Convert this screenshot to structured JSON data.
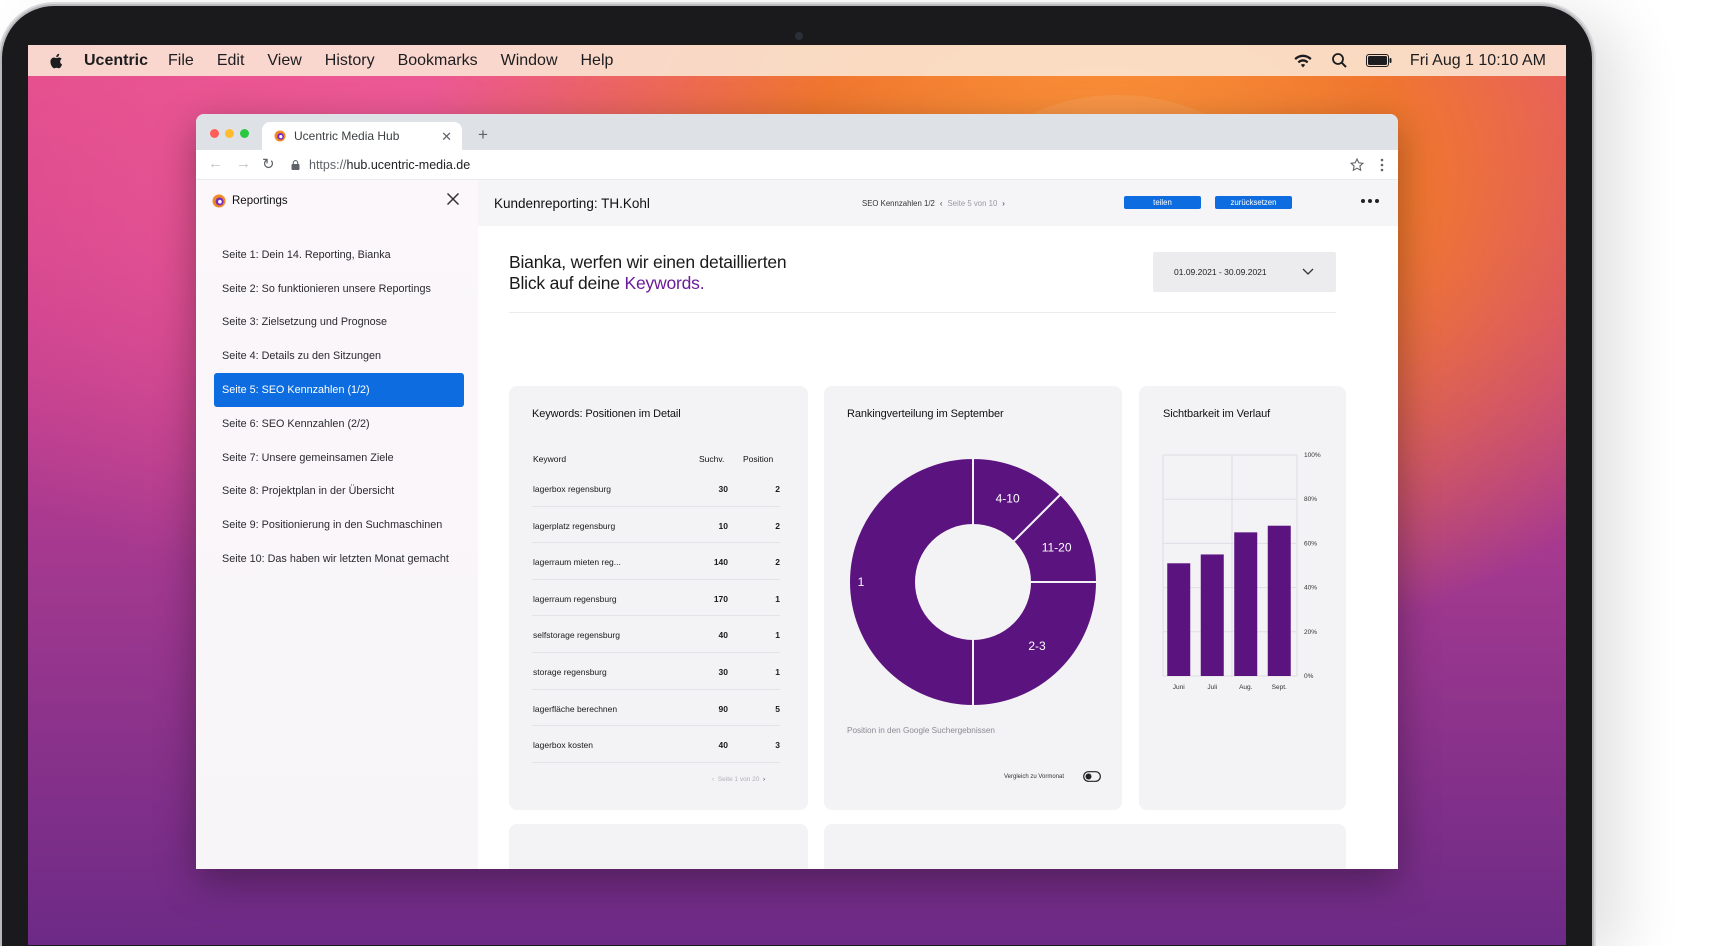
{
  "menubar": {
    "app_name": "Ucentric",
    "items": [
      "File",
      "Edit",
      "View",
      "History",
      "Bookmarks",
      "Window",
      "Help"
    ],
    "clock": "Fri Aug 1  10:10 AM"
  },
  "browser": {
    "tab_title": "Ucentric Media Hub",
    "url_scheme": "https://",
    "url_host": "hub.ucentric-media.de"
  },
  "sidebar": {
    "title": "Reportings",
    "items": [
      {
        "label": "Seite 1: Dein 14. Reporting, Bianka"
      },
      {
        "label": "Seite 2: So funktionieren unsere Reportings"
      },
      {
        "label": "Seite 3: Zielsetzung und Prognose"
      },
      {
        "label": "Seite 4: Details zu den Sitzungen"
      },
      {
        "label": "Seite 5: SEO Kennzahlen (1/2)"
      },
      {
        "label": "Seite 6: SEO Kennzahlen (2/2)"
      },
      {
        "label": "Seite 7: Unsere gemeinsamen Ziele"
      },
      {
        "label": "Seite 8: Projektplan in der Übersicht"
      },
      {
        "label": "Seite 9: Positionierung in den Suchmaschinen"
      },
      {
        "label": "Seite 10: Das haben wir letzten Monat gemacht"
      }
    ],
    "active_index": 4
  },
  "header": {
    "title": "Kundenreporting: TH.Kohl",
    "section": "SEO Kennzahlen 1/2",
    "page_info": "Seite 5 von 10",
    "share_label": "teilen",
    "reset_label": "zurücksetzen"
  },
  "content": {
    "headline_line1": "Bianka, werfen wir einen detaillierten",
    "headline_line2": "Blick auf deine ",
    "headline_accent": "Keywords.",
    "date_range": "01.09.2021 - 30.09.2021"
  },
  "keywords": {
    "title": "Keywords: Positionen im Detail",
    "col_keyword": "Keyword",
    "col_volume": "Suchv.",
    "col_position": "Position",
    "rows": [
      {
        "keyword": "lagerbox regensburg",
        "volume": "30",
        "position": "2"
      },
      {
        "keyword": "lagerplatz regensburg",
        "volume": "10",
        "position": "2"
      },
      {
        "keyword": "lagerraum mieten reg...",
        "volume": "140",
        "position": "2"
      },
      {
        "keyword": "lagerraum regensburg",
        "volume": "170",
        "position": "1"
      },
      {
        "keyword": "selfstorage regensburg",
        "volume": "40",
        "position": "1"
      },
      {
        "keyword": "storage regensburg",
        "volume": "30",
        "position": "1"
      },
      {
        "keyword": "lagerfläche berechnen",
        "volume": "90",
        "position": "5"
      },
      {
        "keyword": "lagerbox kosten",
        "volume": "40",
        "position": "3"
      }
    ],
    "pagination": "Seite 1 von 20"
  },
  "ranking": {
    "title": "Rankingverteilung im September",
    "note": "Position in den Google Suchergebnissen",
    "toggle_label": "Vergleich zu Vormonat"
  },
  "visibility": {
    "title": "Sichtbarkeit im Verlauf"
  },
  "colors": {
    "accent_blue": "#0d6de0",
    "purple": "#6a1b9a",
    "chart_purple": "#5b1380"
  },
  "chart_data": [
    {
      "type": "pie",
      "title": "Rankingverteilung im September",
      "labels": [
        "4-10",
        "11-20",
        "2-3",
        "1"
      ],
      "values": [
        12.5,
        12.5,
        25,
        50
      ],
      "donut": true
    },
    {
      "type": "bar",
      "title": "Sichtbarkeit im Verlauf",
      "categories": [
        "Juni",
        "Juli",
        "Aug.",
        "Sept."
      ],
      "values": [
        51,
        55,
        65,
        68
      ],
      "yticks": [
        "100%",
        "80%",
        "60%",
        "40%",
        "20%",
        "0%"
      ],
      "ylim": [
        0,
        100
      ],
      "grid": true
    }
  ]
}
